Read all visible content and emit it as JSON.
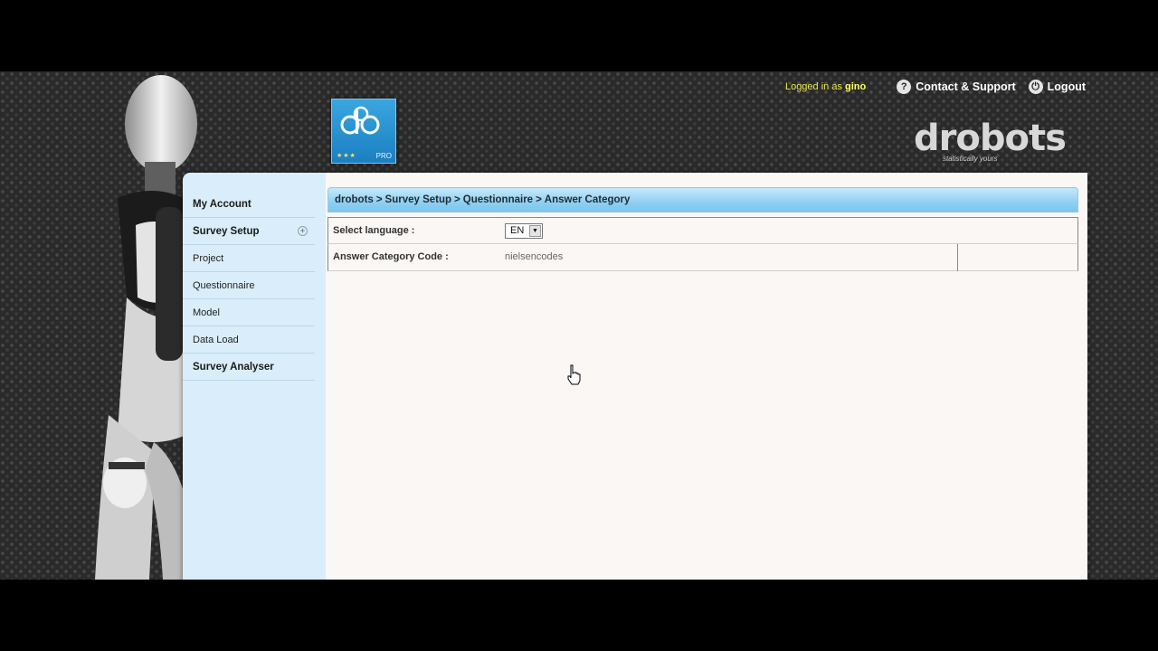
{
  "header": {
    "logged_in_prefix": "Logged in as",
    "username": "gino",
    "contact_label": "Contact & Support",
    "logout_label": "Logout"
  },
  "logo": {
    "badge_label": "PRO",
    "brand_word": "drobots",
    "brand_tagline": "statistically yours"
  },
  "sidebar": {
    "items": [
      {
        "label": "My Account",
        "top": true
      },
      {
        "label": "Survey Setup",
        "top": true,
        "expander": "+"
      },
      {
        "label": "Project",
        "top": false
      },
      {
        "label": "Questionnaire",
        "top": false
      },
      {
        "label": "Model",
        "top": false
      },
      {
        "label": "Data Load",
        "top": false
      },
      {
        "label": "Survey Analyser",
        "top": true
      }
    ]
  },
  "breadcrumb": {
    "items": [
      "drobots",
      "Survey Setup",
      "Questionnaire",
      "Answer Category"
    ],
    "separator": ">"
  },
  "form": {
    "language_label": "Select language :",
    "language_value": "EN",
    "code_label": "Answer Category Code :",
    "code_value": "nielsencodes"
  },
  "colors": {
    "panel_bg": "#d9eefa",
    "breadcrumb_bg": "#8fd0f1",
    "logo_blue": "#1b7fc0",
    "logged_in_yellow": "#e8e84a"
  }
}
